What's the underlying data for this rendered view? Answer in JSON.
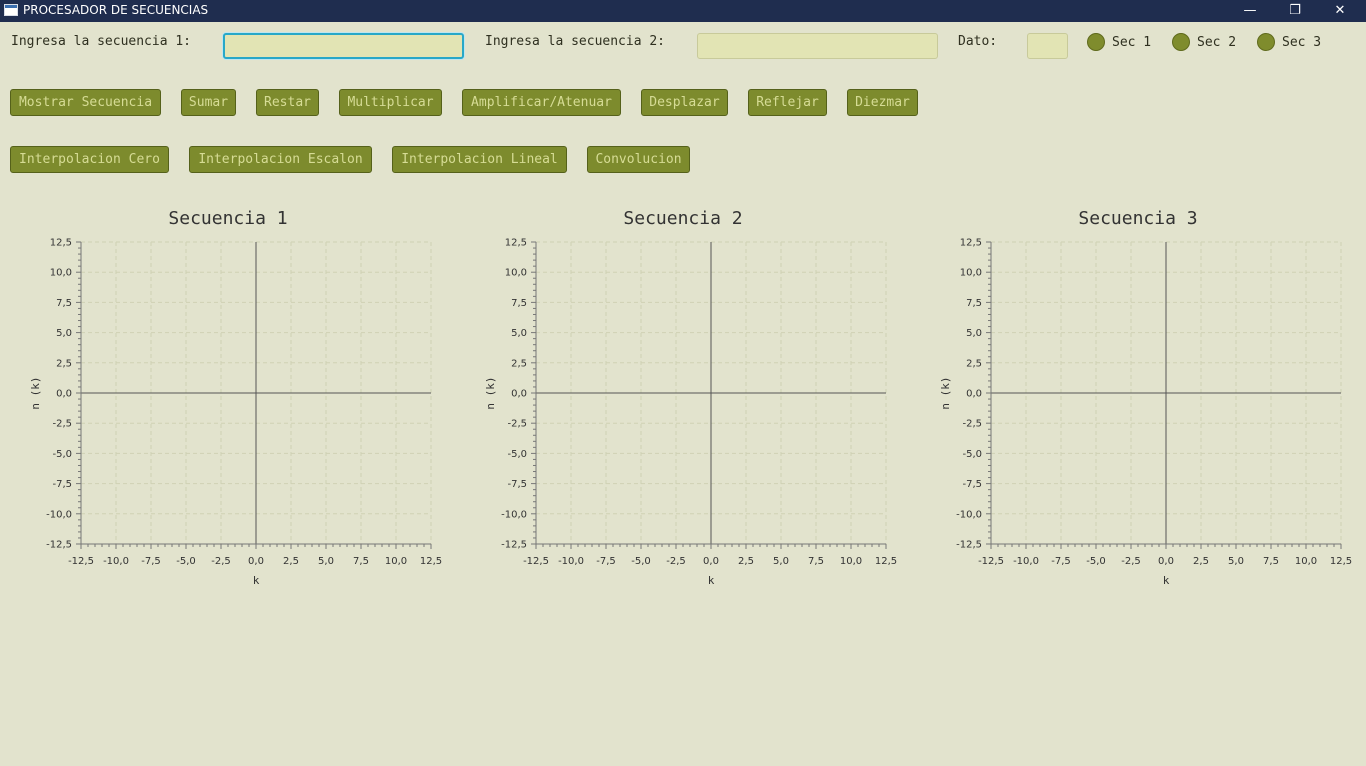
{
  "window": {
    "title": "PROCESADOR DE SECUENCIAS",
    "minimize_glyph": "—",
    "restore_glyph": "❐",
    "close_glyph": "✕"
  },
  "inputs": {
    "seq1_label": "Ingresa la secuencia 1:",
    "seq1_value": "",
    "seq2_label": "Ingresa la secuencia 2:",
    "seq2_value": "",
    "dato_label": "Dato:",
    "dato_value": ""
  },
  "radios": [
    {
      "label": "Sec 1"
    },
    {
      "label": "Sec 2"
    },
    {
      "label": "Sec 3"
    }
  ],
  "buttons_row1": [
    {
      "label": "Mostrar Secuencia"
    },
    {
      "label": "Sumar"
    },
    {
      "label": "Restar"
    },
    {
      "label": "Multiplicar"
    },
    {
      "label": "Amplificar/Atenuar"
    },
    {
      "label": "Desplazar"
    },
    {
      "label": "Reflejar"
    },
    {
      "label": "Diezmar"
    }
  ],
  "buttons_row2": [
    {
      "label": "Interpolacion Cero"
    },
    {
      "label": "Interpolacion Escalon"
    },
    {
      "label": "Interpolacion Lineal"
    },
    {
      "label": "Convolucion"
    }
  ],
  "colors": {
    "background": "#e2e3cd",
    "titlebar": "#1f2d4f",
    "button": "#7d8b2d",
    "button_text": "#d6dc95",
    "field": "#e2e4b4",
    "focus": "#28a8c8"
  },
  "chart_data": [
    {
      "type": "scatter",
      "title": "Secuencia 1",
      "xlabel": "k",
      "ylabel": "n (k)",
      "xlim": [
        -12.5,
        12.5
      ],
      "ylim": [
        -12.5,
        12.5
      ],
      "xticks": [
        "-12,5",
        "-10,0",
        "-7,5",
        "-5,0",
        "-2,5",
        "0,0",
        "2,5",
        "5,0",
        "7,5",
        "10,0",
        "12,5"
      ],
      "yticks": [
        "12,5",
        "10,0",
        "7,5",
        "5,0",
        "2,5",
        "0,0",
        "-2,5",
        "-5,0",
        "-7,5",
        "-10,0",
        "-12,5"
      ],
      "grid": true,
      "series": []
    },
    {
      "type": "scatter",
      "title": "Secuencia 2",
      "xlabel": "k",
      "ylabel": "n (k)",
      "xlim": [
        -12.5,
        12.5
      ],
      "ylim": [
        -12.5,
        12.5
      ],
      "xticks": [
        "-12,5",
        "-10,0",
        "-7,5",
        "-5,0",
        "-2,5",
        "0,0",
        "2,5",
        "5,0",
        "7,5",
        "10,0",
        "12,5"
      ],
      "yticks": [
        "12,5",
        "10,0",
        "7,5",
        "5,0",
        "2,5",
        "0,0",
        "-2,5",
        "-5,0",
        "-7,5",
        "-10,0",
        "-12,5"
      ],
      "grid": true,
      "series": []
    },
    {
      "type": "scatter",
      "title": "Secuencia 3",
      "xlabel": "k",
      "ylabel": "n (k)",
      "xlim": [
        -12.5,
        12.5
      ],
      "ylim": [
        -12.5,
        12.5
      ],
      "xticks": [
        "-12,5",
        "-10,0",
        "-7,5",
        "-5,0",
        "-2,5",
        "0,0",
        "2,5",
        "5,0",
        "7,5",
        "10,0",
        "12,5"
      ],
      "yticks": [
        "12,5",
        "10,0",
        "7,5",
        "5,0",
        "2,5",
        "0,0",
        "-2,5",
        "-5,0",
        "-7,5",
        "-10,0",
        "-12,5"
      ],
      "grid": true,
      "series": []
    }
  ]
}
